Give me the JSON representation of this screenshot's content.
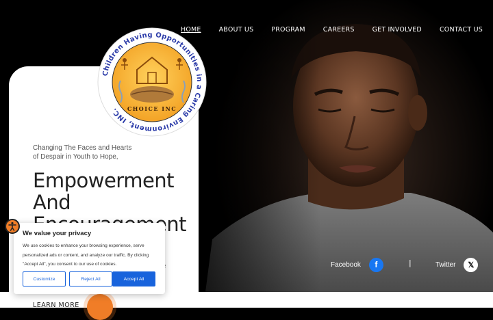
{
  "nav": {
    "items": [
      {
        "label": "HOME"
      },
      {
        "label": "ABOUT US"
      },
      {
        "label": "PROGRAM"
      },
      {
        "label": "CAREERS"
      },
      {
        "label": "GET INVOLVED"
      },
      {
        "label": "CONTACT US"
      }
    ],
    "active_index": 0
  },
  "logo": {
    "ring_text": "Children Having Opportunities in a Caring Environment, INC.",
    "center_text": "CHOICE INC"
  },
  "hero": {
    "tagline_line1": "Changing The Faces and Hearts",
    "tagline_line2": "of Despair in Youth to Hope,",
    "headline_line1": "Empowerment",
    "headline_line2": "And",
    "headline_line3": "Encouragement",
    "partial_text": "ce",
    "learn_more": "LEARN MORE"
  },
  "cookie_banner": {
    "title": "We value your privacy",
    "body": "We use cookies to enhance your browsing experience, serve personalized ads or content, and analyze our traffic. By clicking \"Accept All\", you consent to our use of cookies.",
    "customize": "Customize",
    "reject": "Reject All",
    "accept": "Accept All"
  },
  "social": {
    "facebook_label": "Facebook",
    "twitter_label": "Twitter",
    "divider": "|",
    "facebook_glyph": "f",
    "twitter_glyph": "𝕏"
  },
  "colors": {
    "accent_orange": "#f07d27",
    "cookie_blue": "#1863dc",
    "facebook_blue": "#1877f2"
  }
}
